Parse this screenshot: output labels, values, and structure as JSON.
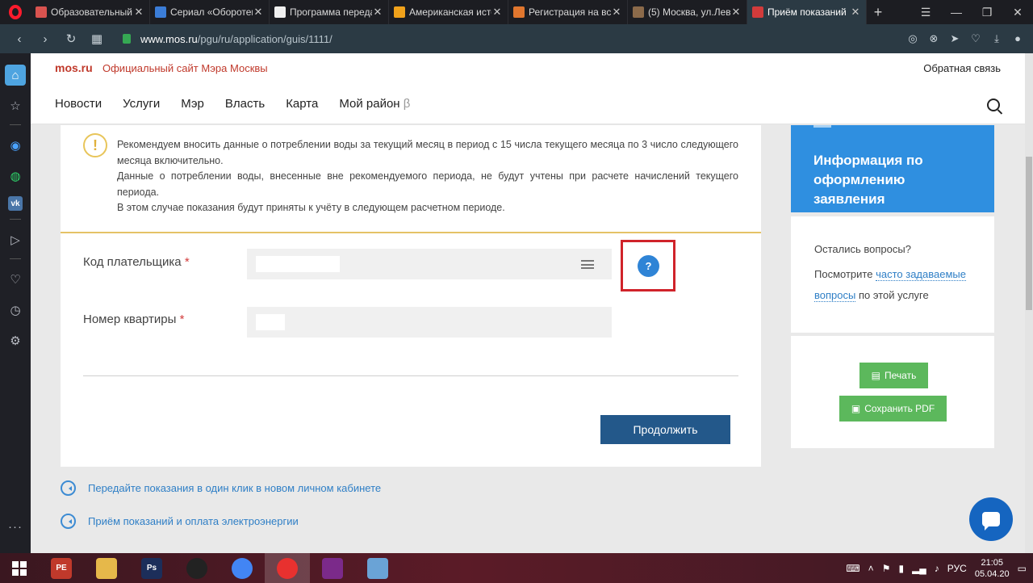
{
  "browser": {
    "tabs": [
      {
        "title": "Образовательный",
        "color": "#d9534f"
      },
      {
        "title": "Сериал «Оборотен",
        "color": "#3b7dd8"
      },
      {
        "title": "Программа переда",
        "color": "#f0f0f0"
      },
      {
        "title": "Американская исто",
        "color": "#f0a21b"
      },
      {
        "title": "Регистрация на вст",
        "color": "#e0762e"
      },
      {
        "title": "(5) Москва, ул.Лев",
        "color": "#8b6a4a"
      },
      {
        "title": "Приём показаний",
        "color": "#d23b3b"
      }
    ],
    "url_domain": "www.mos.ru",
    "url_path": "/pgu/ru/application/guis/1111/"
  },
  "site": {
    "brand": "mos.ru",
    "brand_subtitle": "Официальный сайт Мэра Москвы",
    "feedback": "Обратная связь",
    "nav": [
      "Новости",
      "Услуги",
      "Мэр",
      "Власть",
      "Карта",
      "Мой район"
    ],
    "nav_beta": "β"
  },
  "form": {
    "notice_lines": [
      "Рекомендуем вносить данные о потреблении воды за текущий месяц в период с 15 числа текущего месяца по 3 число следующего месяца включительно.",
      "Данные о потреблении воды, внесенные вне рекомендуемого периода, не будут учтены при расчете начислений текущего периода.",
      "В этом случае показания будут приняты к учёту в следующем расчетном периоде."
    ],
    "payer_label": "Код плательщика",
    "apartment_label": "Номер квартиры",
    "required_mark": "*",
    "payer_value": "",
    "apartment_value": "",
    "help": "?",
    "continue": "Продолжить"
  },
  "links": [
    "Передайте показания в один клик в новом личном кабинете",
    "Приём показаний и оплата электроэнергии"
  ],
  "aside": {
    "info_title": "Информация по оформлению заявления",
    "questions_title": "Остались вопросы?",
    "questions_prefix": "Посмотрите",
    "questions_link": "часто задаваемые вопросы",
    "questions_suffix": "по этой услуге",
    "print": "Печать",
    "save_pdf": "Сохранить PDF"
  },
  "taskbar": {
    "apps": [
      {
        "name": "pe",
        "label": "PE",
        "color": "#c0392b"
      },
      {
        "name": "explorer",
        "label": "",
        "color": "#e6b84a"
      },
      {
        "name": "photoshop",
        "label": "Ps",
        "color": "#1c2e5a"
      },
      {
        "name": "camera",
        "label": "",
        "color": "#222222"
      },
      {
        "name": "chrome",
        "label": "",
        "color": "#4285f4"
      },
      {
        "name": "opera",
        "label": "",
        "color": "#e8312f"
      },
      {
        "name": "floppy",
        "label": "",
        "color": "#7b2a8a"
      },
      {
        "name": "paint",
        "label": "",
        "color": "#6aa3d6"
      }
    ],
    "lang": "РУС",
    "time": "21:05",
    "date": "05.04.20"
  }
}
